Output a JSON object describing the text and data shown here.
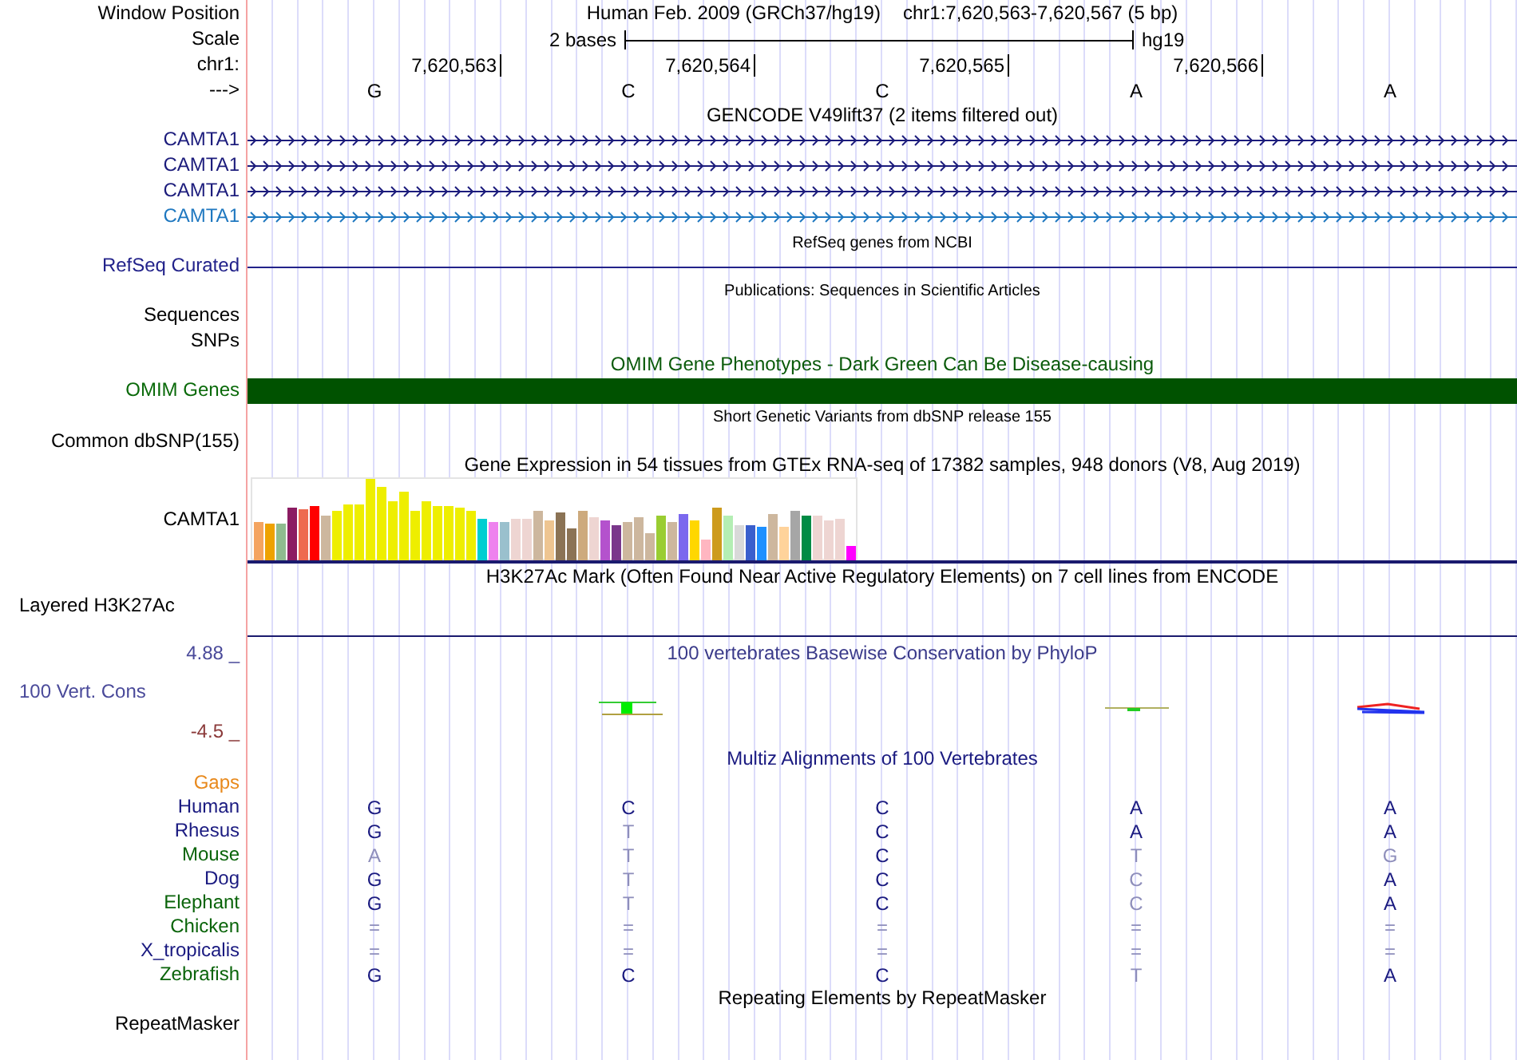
{
  "header": {
    "window_position_label": "Window Position",
    "assembly": "Human Feb. 2009 (GRCh37/hg19)",
    "position": "chr1:7,620,563-7,620,567 (5 bp)",
    "scale_label": "Scale",
    "scale_text": "2 bases",
    "scale_assembly": "hg19",
    "chrom_label": "chr1:",
    "ticks": [
      "7,620,563",
      "7,620,564",
      "7,620,565",
      "7,620,566"
    ],
    "strand_label": "--->",
    "bases": [
      "G",
      "C",
      "C",
      "A",
      "A"
    ]
  },
  "tracks": [
    {
      "kind": "genes",
      "title": "GENCODE V49lift37 (2 items filtered out)",
      "genes": [
        {
          "label": "CAMTA1",
          "color": "#1c1c7c"
        },
        {
          "label": "CAMTA1",
          "color": "#1c1c7c"
        },
        {
          "label": "CAMTA1",
          "color": "#1c1c7c"
        },
        {
          "label": "CAMTA1",
          "color": "#1f78c0"
        }
      ]
    },
    {
      "kind": "line",
      "title": "RefSeq genes from NCBI",
      "label": "RefSeq Curated",
      "color": "#22228a"
    },
    {
      "kind": "labels",
      "title": "Publications: Sequences in Scientific Articles",
      "labels": [
        "Sequences",
        "SNPs"
      ]
    },
    {
      "kind": "bar",
      "title": "OMIM Gene Phenotypes - Dark Green Can Be Disease-causing",
      "label": "OMIM Genes",
      "color": "#005200"
    },
    {
      "kind": "labels",
      "title": "Short Genetic Variants from dbSNP release 155",
      "labels": [
        "Common dbSNP(155)"
      ]
    },
    {
      "kind": "expression",
      "title": "Gene Expression in 54 tissues from GTEx RNA-seq of 17382 samples, 948 donors (V8, Aug 2019)",
      "label": "CAMTA1"
    },
    {
      "kind": "layered",
      "title": "H3K27Ac Mark (Often Found Near Active Regulatory Elements) on 7 cell lines from ENCODE",
      "label": "Layered H3K27Ac"
    },
    {
      "kind": "conservation",
      "title": "100 vertebrates Basewise Conservation by PhyloP",
      "label": "100 Vert. Cons",
      "max": "4.88 _",
      "min": "-4.5 _"
    },
    {
      "kind": "alignment",
      "title": "Multiz Alignments of 100 Vertebrates",
      "gaps_label": "Gaps",
      "species": [
        {
          "name": "Human",
          "color": "#1a1a80",
          "bases": [
            {
              "text": "G",
              "faded": false
            },
            {
              "text": "C",
              "faded": false
            },
            {
              "text": "C",
              "faded": false
            },
            {
              "text": "A",
              "faded": false
            },
            {
              "text": "A",
              "faded": false
            }
          ]
        },
        {
          "name": "Rhesus",
          "color": "#1a1a80",
          "bases": [
            {
              "text": "G",
              "faded": false
            },
            {
              "text": "T",
              "faded": true
            },
            {
              "text": "C",
              "faded": false
            },
            {
              "text": "A",
              "faded": false
            },
            {
              "text": "A",
              "faded": false
            }
          ]
        },
        {
          "name": "Mouse",
          "color": "#0a640a",
          "bases": [
            {
              "text": "A",
              "faded": true
            },
            {
              "text": "T",
              "faded": true
            },
            {
              "text": "C",
              "faded": false
            },
            {
              "text": "T",
              "faded": true
            },
            {
              "text": "G",
              "faded": true
            }
          ]
        },
        {
          "name": "Dog",
          "color": "#1a1a80",
          "bases": [
            {
              "text": "G",
              "faded": false
            },
            {
              "text": "T",
              "faded": true
            },
            {
              "text": "C",
              "faded": false
            },
            {
              "text": "C",
              "faded": true
            },
            {
              "text": "A",
              "faded": false
            }
          ]
        },
        {
          "name": "Elephant",
          "color": "#0a640a",
          "bases": [
            {
              "text": "G",
              "faded": false
            },
            {
              "text": "T",
              "faded": true
            },
            {
              "text": "C",
              "faded": false
            },
            {
              "text": "C",
              "faded": true
            },
            {
              "text": "A",
              "faded": false
            }
          ]
        },
        {
          "name": "Chicken",
          "color": "#0a640a",
          "bases": [
            {
              "text": "=",
              "faded": true
            },
            {
              "text": "=",
              "faded": true
            },
            {
              "text": "=",
              "faded": true
            },
            {
              "text": "=",
              "faded": true
            },
            {
              "text": "=",
              "faded": true
            }
          ]
        },
        {
          "name": "X_tropicalis",
          "color": "#1a1a80",
          "bases": [
            {
              "text": "=",
              "faded": true
            },
            {
              "text": "=",
              "faded": true
            },
            {
              "text": "=",
              "faded": true
            },
            {
              "text": "=",
              "faded": true
            },
            {
              "text": "=",
              "faded": true
            }
          ]
        },
        {
          "name": "Zebrafish",
          "color": "#0a640a",
          "bases": [
            {
              "text": "G",
              "faded": false
            },
            {
              "text": "C",
              "faded": false
            },
            {
              "text": "C",
              "faded": false
            },
            {
              "text": "T",
              "faded": true
            },
            {
              "text": "A",
              "faded": false
            }
          ]
        }
      ]
    },
    {
      "kind": "repeats",
      "title": "Repeating Elements by RepeatMasker",
      "label": "RepeatMasker"
    }
  ]
}
